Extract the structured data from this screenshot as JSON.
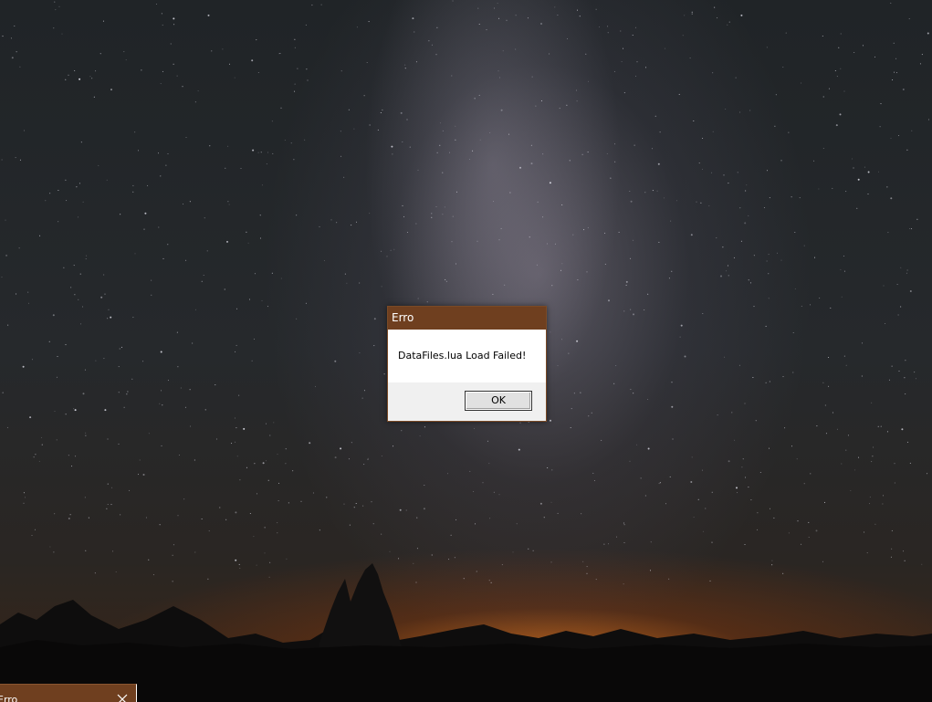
{
  "dialog": {
    "title": "Erro",
    "message": "DataFiles.lua Load Failed!",
    "ok_label": "OK"
  },
  "partial_window": {
    "title": "Erro",
    "close_icon": "close-icon"
  },
  "colors": {
    "titlebar": "#6f3f1f",
    "dialog_footer": "#f0f0f0"
  }
}
